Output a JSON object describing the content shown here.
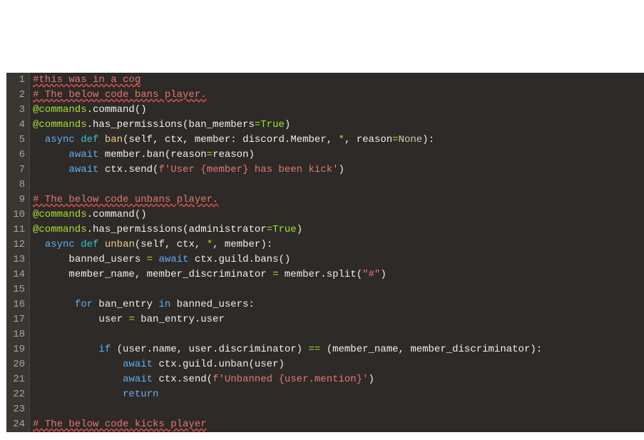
{
  "chart_data": null,
  "editor": {
    "background": "#2d2a28",
    "foreground": "#f8f8f2",
    "gutter_bg": "#3a3632",
    "gutter_fg": "#a8a39d"
  },
  "line_numbers": [
    "1",
    "2",
    "3",
    "4",
    "5",
    "6",
    "7",
    "8",
    "9",
    "10",
    "11",
    "12",
    "13",
    "14",
    "15",
    "16",
    "17",
    "18",
    "19",
    "20",
    "21",
    "22",
    "23",
    "24"
  ],
  "code": {
    "l1": {
      "c1": "#this was in a cog"
    },
    "l2": {
      "c1": "# The below code bans player."
    },
    "l3": {
      "c1": "@commands",
      "c2": ".command()"
    },
    "l4": {
      "c1": "@commands",
      "c2": ".has_permissions(ban_members",
      "c3": "=",
      "c4": "True",
      "c5": ")"
    },
    "l5": {
      "i": "  ",
      "c1": "async",
      "c2": " ",
      "c3": "def",
      "c4": " ",
      "c5": "ban",
      "c6": "(self, ctx, member: discord.Member, ",
      "c7": "*",
      "c8": ", reason",
      "c9": "=",
      "c10": "None",
      "c11": "):"
    },
    "l6": {
      "i": "      ",
      "c1": "await",
      "c2": " member.ban(reason",
      "c3": "=",
      "c4": "reason)"
    },
    "l7": {
      "i": "      ",
      "c1": "await",
      "c2": " ctx.send(",
      "c3": "f'User {member} has been kick'",
      "c4": ")"
    },
    "l8": {
      "c1": ""
    },
    "l9": {
      "c1": "# The below code unbans player."
    },
    "l10": {
      "c1": "@commands",
      "c2": ".command()"
    },
    "l11": {
      "c1": "@commands",
      "c2": ".has_permissions(administrator",
      "c3": "=",
      "c4": "True",
      "c5": ")"
    },
    "l12": {
      "i": "  ",
      "c1": "async",
      "c2": " ",
      "c3": "def",
      "c4": " ",
      "c5": "unban",
      "c6": "(self, ctx, ",
      "c7": "*",
      "c8": ", member):"
    },
    "l13": {
      "i": "      ",
      "c1": "banned_users ",
      "c2": "=",
      "c3": " ",
      "c4": "await",
      "c5": " ctx.guild.bans()"
    },
    "l14": {
      "i": "      ",
      "c1": "member_name, member_discriminator ",
      "c2": "=",
      "c3": " member.split(",
      "c4": "\"#\"",
      "c5": ")"
    },
    "l15": {
      "c1": ""
    },
    "l16": {
      "i": "       ",
      "c1": "for",
      "c2": " ban_entry ",
      "c3": "in",
      "c4": " banned_users:"
    },
    "l17": {
      "i": "           ",
      "c1": "user ",
      "c2": "=",
      "c3": " ban_entry.user"
    },
    "l18": {
      "c1": ""
    },
    "l19": {
      "i": "           ",
      "c1": "if",
      "c2": " (user.name, user.discriminator) ",
      "c3": "==",
      "c4": " (member_name, member_discriminator):"
    },
    "l20": {
      "i": "               ",
      "c1": "await",
      "c2": " ctx.guild.unban(user)"
    },
    "l21": {
      "i": "               ",
      "c1": "await",
      "c2": " ctx.send(",
      "c3": "f'Unbanned {user.mention}'",
      "c4": ")"
    },
    "l22": {
      "i": "               ",
      "c1": "return"
    },
    "l23": {
      "c1": ""
    },
    "l24": {
      "c1": "# The below code kicks player"
    }
  }
}
